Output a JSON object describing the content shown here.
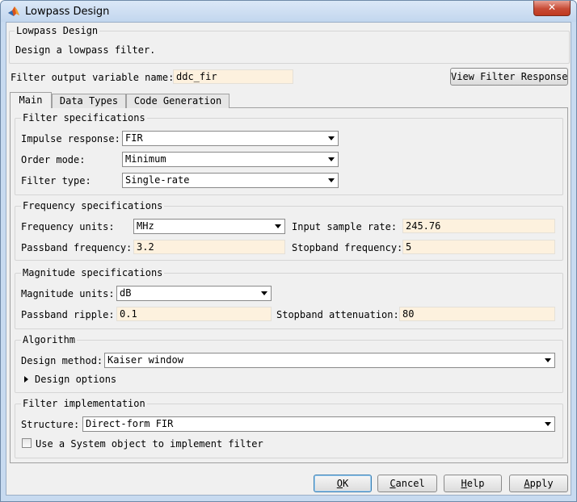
{
  "window": {
    "title": "Lowpass Design",
    "close_glyph": "✕",
    "icon": "matlab-logo-icon"
  },
  "header": {
    "group_title": "Lowpass Design",
    "description": "Design a lowpass filter."
  },
  "output": {
    "label": "Filter output variable name:",
    "value": "ddc_fir",
    "view_button": "View Filter Response"
  },
  "tabs": [
    {
      "label": "Main",
      "active": true
    },
    {
      "label": "Data Types",
      "active": false
    },
    {
      "label": "Code Generation",
      "active": false
    }
  ],
  "filter_specs": {
    "title": "Filter specifications",
    "impulse_label": "Impulse response:",
    "impulse_value": "FIR",
    "order_label": "Order mode:",
    "order_value": "Minimum",
    "type_label": "Filter type:",
    "type_value": "Single-rate"
  },
  "freq_specs": {
    "title": "Frequency specifications",
    "units_label": "Frequency units:",
    "units_value": "MHz",
    "sample_label": "Input sample rate:",
    "sample_value": "245.76",
    "passband_label": "Passband frequency:",
    "passband_value": "3.2",
    "stopband_label": "Stopband frequency:",
    "stopband_value": "5"
  },
  "mag_specs": {
    "title": "Magnitude specifications",
    "units_label": "Magnitude units:",
    "units_value": "dB",
    "ripple_label": "Passband ripple:",
    "ripple_value": "0.1",
    "atten_label": "Stopband attenuation:",
    "atten_value": "80"
  },
  "algorithm": {
    "title": "Algorithm",
    "method_label": "Design method:",
    "method_value": "Kaiser window",
    "options_label": "Design options"
  },
  "implementation": {
    "title": "Filter implementation",
    "structure_label": "Structure:",
    "structure_value": "Direct-form FIR",
    "system_object_label": "Use a System object to implement filter",
    "system_object_checked": false
  },
  "buttons": {
    "ok": {
      "mnemonic": "O",
      "rest": "K"
    },
    "cancel": {
      "mnemonic": "C",
      "rest": "ancel"
    },
    "help": {
      "mnemonic": "H",
      "rest": "elp"
    },
    "apply": {
      "mnemonic": "A",
      "rest": "pply"
    }
  }
}
